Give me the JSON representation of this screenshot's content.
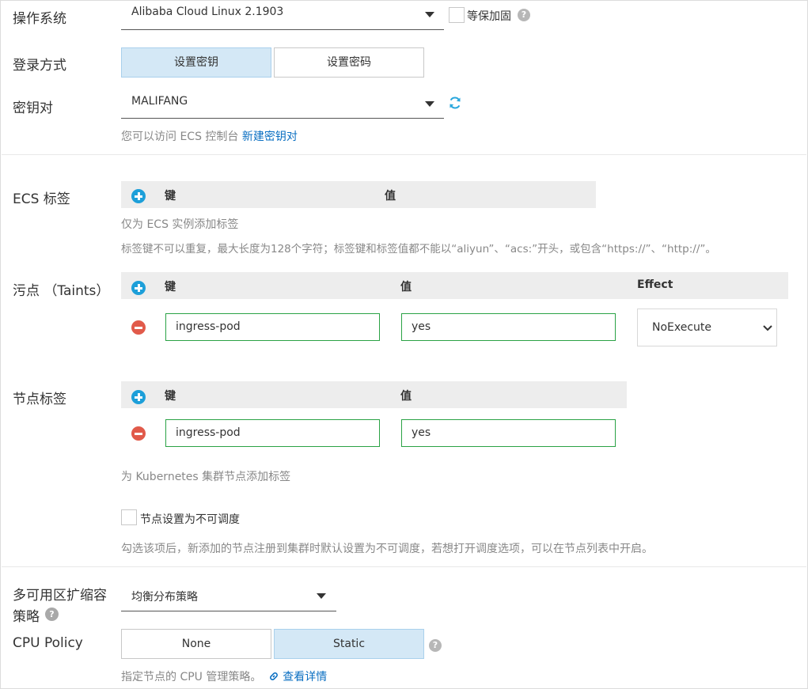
{
  "os": {
    "label": "操作系统",
    "value": "Alibaba Cloud Linux 2.1903",
    "hardening_label": "等保加固"
  },
  "login": {
    "label": "登录方式",
    "options": [
      "设置密钥",
      "设置密码"
    ],
    "selected": "设置密钥"
  },
  "keypair": {
    "label": "密钥对",
    "value": "MALIFANG",
    "hint_prefix": "您可以访问 ECS 控制台",
    "hint_link": "新建密钥对"
  },
  "ecs_tags": {
    "label": "ECS 标签",
    "col_key": "键",
    "col_value": "值",
    "hint1": "仅为 ECS 实例添加标签",
    "hint2": "标签键不可以重复，最大长度为128个字符；标签键和标签值都不能以“aliyun”、“acs:”开头，或包含“https://”、“http://”。"
  },
  "taints": {
    "label": "污点 （Taints）",
    "col_key": "键",
    "col_value": "值",
    "col_effect": "Effect",
    "rows": [
      {
        "key": "ingress-pod",
        "value": "yes",
        "effect": "NoExecute"
      }
    ]
  },
  "node_labels": {
    "label": "节点标签",
    "col_key": "键",
    "col_value": "值",
    "rows": [
      {
        "key": "ingress-pod",
        "value": "yes"
      }
    ],
    "hint": "为 Kubernetes 集群节点添加标签",
    "unschedulable_label": "节点设置为不可调度",
    "unschedulable_hint": "勾选该项后，新添加的节点注册到集群时默认设置为不可调度，若想打开调度选项，可以在节点列表中开启。"
  },
  "scaling": {
    "label_line1": "多可用区扩缩容",
    "label_line2": "策略",
    "value": "均衡分布策略"
  },
  "cpu_policy": {
    "label": "CPU Policy",
    "options": [
      "None",
      "Static"
    ],
    "selected": "Static",
    "hint_prefix": "指定节点的 CPU 管理策略。",
    "hint_link": "查看详情"
  }
}
